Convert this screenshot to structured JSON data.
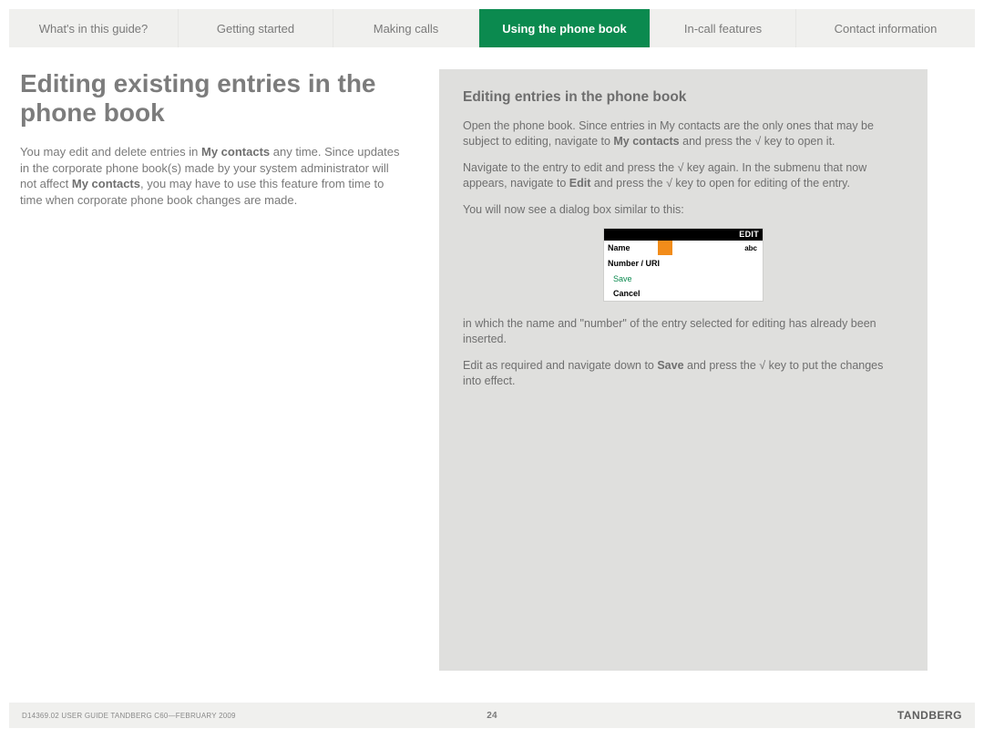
{
  "nav": {
    "items": [
      {
        "label": "What's in this guide?",
        "active": false
      },
      {
        "label": "Getting started",
        "active": false
      },
      {
        "label": "Making calls",
        "active": false
      },
      {
        "label": "Using the phone book",
        "active": true
      },
      {
        "label": "In-call features",
        "active": false
      },
      {
        "label": "Contact information",
        "active": false
      }
    ]
  },
  "left": {
    "title": "Editing existing entries in the phone book",
    "p1a": "You may edit and delete entries in ",
    "p1b": "My contacts",
    "p1c": " any time. Since updates in the corporate phone book(s) made by your system administrator will not affect ",
    "p1d": "My contacts",
    "p1e": ", you may have to use this feature from time to time when corporate phone book changes are made."
  },
  "right": {
    "heading": "Editing entries in the phone book",
    "p1a": "Open the phone book. Since entries in My contacts are the only ones that may be subject to editing, navigate to ",
    "p1b": "My contacts",
    "p1c": " and press the ",
    "p1d": " key to open it.",
    "p2a": "Navigate to the entry to edit and press the ",
    "p2b": " key again. In the submenu that now appears, navigate to ",
    "p2c": "Edit",
    "p2d": " and press the ",
    "p2e": " key to open for editing of the entry.",
    "p3": "You will now see a dialog box similar to this:",
    "p4": "in which the name and \"number\" of the entry selected for editing has already been inserted.",
    "p5a": "Edit as required and navigate down to ",
    "p5b": "Save",
    "p5c": " and press the ",
    "p5d": " key to put the changes into effect."
  },
  "dialog": {
    "title": "EDIT",
    "row1_label": "Name",
    "row1_hint": "abc",
    "row2_label": "Number / URI",
    "save": "Save",
    "cancel": "Cancel"
  },
  "check": "√",
  "footer": {
    "doc": "D14369.02 USER GUIDE TANDBERG C60—FEBRUARY 2009",
    "page": "24",
    "brand": "TANDBERG"
  }
}
